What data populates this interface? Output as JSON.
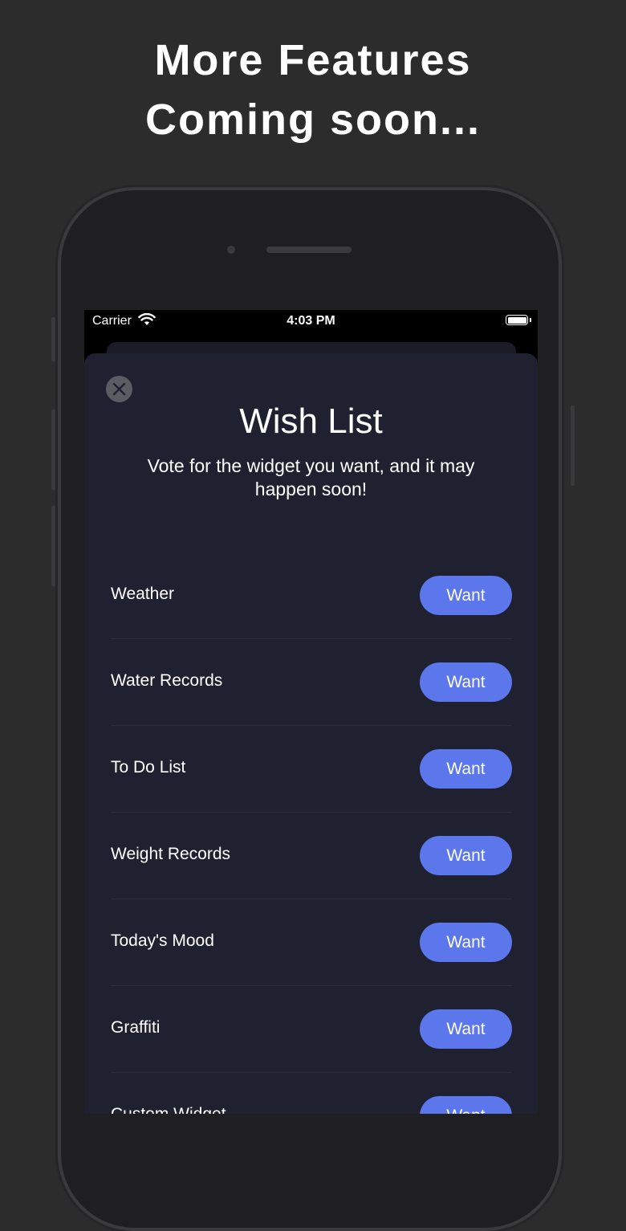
{
  "headline": {
    "line1": "More Features",
    "line2": "Coming soon..."
  },
  "status_bar": {
    "carrier": "Carrier",
    "time": "4:03 PM",
    "icons": [
      "wifi-icon",
      "battery-icon"
    ]
  },
  "sheet": {
    "close_icon": "close-icon",
    "title": "Wish List",
    "subtitle": "Vote for the widget you want, and it may happen soon!",
    "items": [
      {
        "label": "Weather",
        "button": "Want"
      },
      {
        "label": "Water Records",
        "button": "Want"
      },
      {
        "label": "To Do List",
        "button": "Want"
      },
      {
        "label": "Weight Records",
        "button": "Want"
      },
      {
        "label": "Today's Mood",
        "button": "Want"
      },
      {
        "label": "Graffiti",
        "button": "Want"
      },
      {
        "label": "Custom Widget",
        "button": "Want"
      }
    ]
  },
  "colors": {
    "page_bg": "#2c2c2c",
    "sheet_bg": "#1f2030",
    "accent": "#5b77eb"
  }
}
